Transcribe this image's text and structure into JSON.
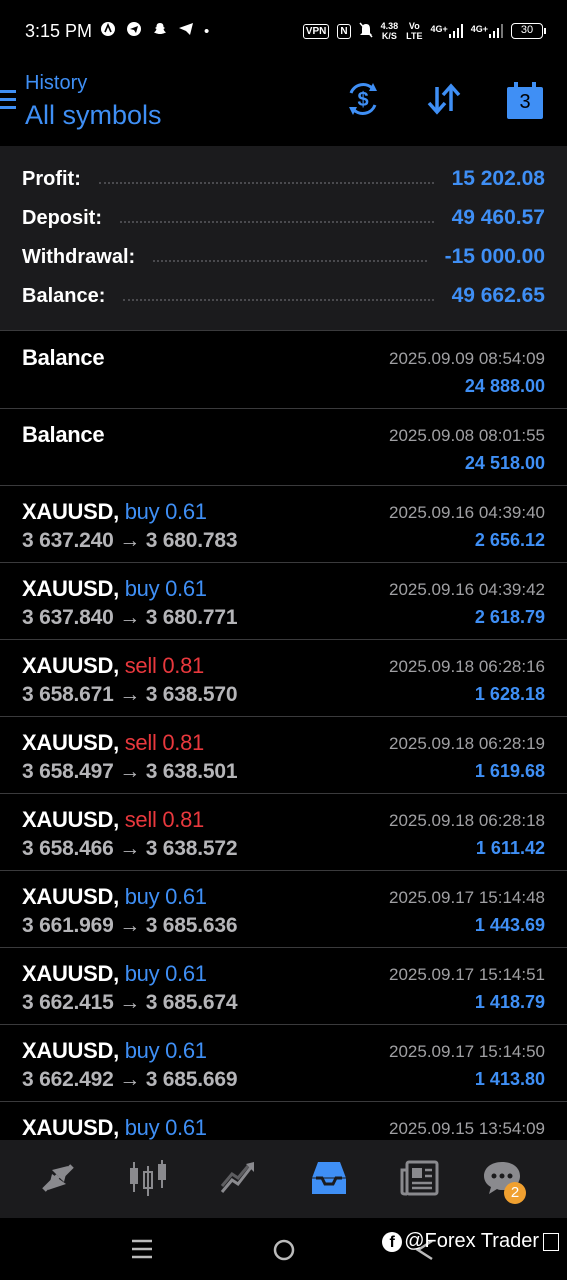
{
  "status_bar": {
    "time": "3:15 PM",
    "vpn": "VPN",
    "nfc": "N",
    "speed": "4.38",
    "speed_unit": "K/S",
    "volte_top": "Vo",
    "volte_bottom": "LTE",
    "net1": "4G+",
    "net2": "4G+",
    "battery": "30",
    "dot": "•"
  },
  "header": {
    "subtitle": "History",
    "title": "All symbols",
    "calendar_day": "3"
  },
  "summary": [
    {
      "label": "Profit:",
      "value": "15 202.08"
    },
    {
      "label": "Deposit:",
      "value": "49 460.57"
    },
    {
      "label": "Withdrawal:",
      "value": "-15 000.00"
    },
    {
      "label": "Balance:",
      "value": "49 662.65"
    }
  ],
  "deals": [
    {
      "symbol": "Balance",
      "type": "",
      "volume": "",
      "prices": "",
      "time": "2025.09.09 08:54:09",
      "profit": "24 888.00"
    },
    {
      "symbol": "Balance",
      "type": "",
      "volume": "",
      "prices": "",
      "time": "2025.09.08 08:01:55",
      "profit": "24 518.00"
    },
    {
      "symbol": "XAUUSD,",
      "type": "buy 0.61",
      "side": "buy",
      "prices": "3 637.240 → 3 680.783",
      "time": "2025.09.16 04:39:40",
      "profit": "2 656.12"
    },
    {
      "symbol": "XAUUSD,",
      "type": "buy 0.61",
      "side": "buy",
      "prices": "3 637.840 → 3 680.771",
      "time": "2025.09.16 04:39:42",
      "profit": "2 618.79"
    },
    {
      "symbol": "XAUUSD,",
      "type": "sell 0.81",
      "side": "sell",
      "prices": "3 658.671 → 3 638.570",
      "time": "2025.09.18 06:28:16",
      "profit": "1 628.18"
    },
    {
      "symbol": "XAUUSD,",
      "type": "sell 0.81",
      "side": "sell",
      "prices": "3 658.497 → 3 638.501",
      "time": "2025.09.18 06:28:19",
      "profit": "1 619.68"
    },
    {
      "symbol": "XAUUSD,",
      "type": "sell 0.81",
      "side": "sell",
      "prices": "3 658.466 → 3 638.572",
      "time": "2025.09.18 06:28:18",
      "profit": "1 611.42"
    },
    {
      "symbol": "XAUUSD,",
      "type": "buy 0.61",
      "side": "buy",
      "prices": "3 661.969 → 3 685.636",
      "time": "2025.09.17 15:14:48",
      "profit": "1 443.69"
    },
    {
      "symbol": "XAUUSD,",
      "type": "buy 0.61",
      "side": "buy",
      "prices": "3 662.415 → 3 685.674",
      "time": "2025.09.17 15:14:51",
      "profit": "1 418.79"
    },
    {
      "symbol": "XAUUSD,",
      "type": "buy 0.61",
      "side": "buy",
      "prices": "3 662.492 → 3 685.669",
      "time": "2025.09.17 15:14:50",
      "profit": "1 413.80"
    },
    {
      "symbol": "XAUUSD,",
      "type": "buy 0.61",
      "side": "buy",
      "prices": "",
      "time": "2025.09.15 13:54:09",
      "profit": ""
    }
  ],
  "bottom_nav": {
    "items": [
      {
        "icon": "quotes-icon"
      },
      {
        "icon": "chart-icon"
      },
      {
        "icon": "trade-icon"
      },
      {
        "icon": "history-icon",
        "active": true
      },
      {
        "icon": "news-icon"
      },
      {
        "icon": "messages-icon",
        "badge": "2"
      }
    ]
  },
  "watermark": {
    "text": "@Forex Trader"
  },
  "colors": {
    "accent": "#3f8ff5",
    "sell": "#e8383d",
    "background": "#000000",
    "panel": "#1b1b1d"
  }
}
